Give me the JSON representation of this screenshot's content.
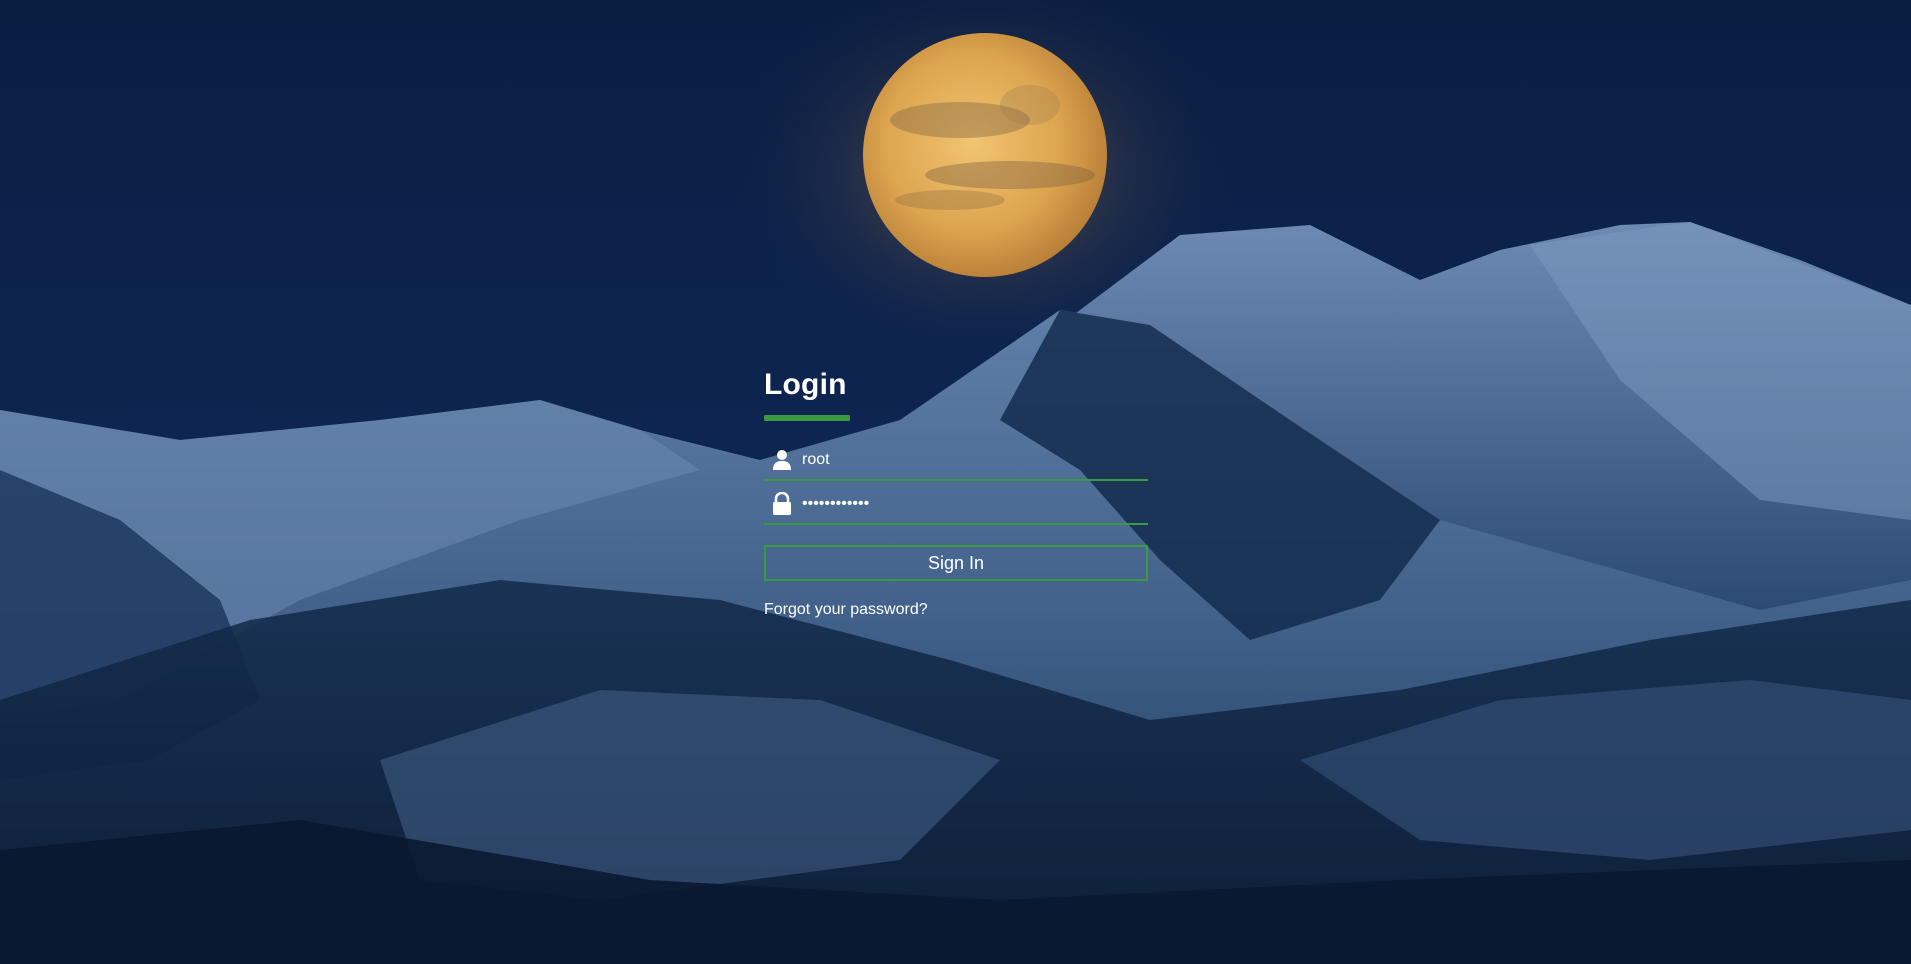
{
  "login": {
    "title": "Login",
    "username": {
      "value": "root",
      "icon": "user-icon"
    },
    "password": {
      "value": "••••••••••••",
      "icon": "lock-icon"
    },
    "signin_label": "Sign In",
    "forgot_label": "Forgot your password?"
  },
  "colors": {
    "accent": "#3b9a3f",
    "text": "#ffffff",
    "sky": "#0b1f3f",
    "moon": "#e8b35a"
  }
}
